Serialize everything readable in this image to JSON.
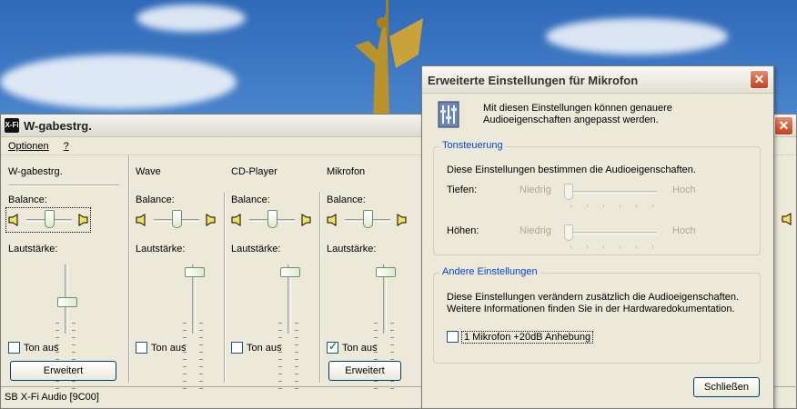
{
  "mixer": {
    "title": "W-gabestrg.",
    "menu": {
      "options": "Optionen",
      "help": "?"
    },
    "channels": [
      {
        "name": "W-gabestrg.",
        "balance_label": "Balance:",
        "volume_label": "Lautstärke:",
        "mute_label": "Ton aus",
        "muted": false,
        "has_advanced": true,
        "volume_level": 0.4
      },
      {
        "name": "Wave",
        "balance_label": "Balance:",
        "volume_label": "Lautstärke:",
        "mute_label": "Ton aus",
        "muted": false,
        "has_advanced": false,
        "volume_level": 0.95
      },
      {
        "name": "CD-Player",
        "balance_label": "Balance:",
        "volume_label": "Lautstärke:",
        "mute_label": "Ton aus",
        "muted": false,
        "has_advanced": false,
        "volume_level": 0.95
      },
      {
        "name": "Mikrofon",
        "balance_label": "Balance:",
        "volume_label": "Lautstärke:",
        "mute_label": "Ton aus",
        "muted": true,
        "has_advanced": true,
        "volume_level": 0.95
      }
    ],
    "advanced_label": "Erweitert",
    "status": "SB X-Fi Audio [9C00]"
  },
  "dialog": {
    "title": "Erweiterte Einstellungen für Mikrofon",
    "description": "Mit diesen Einstellungen können genauere Audioeigenschaften angepasst werden.",
    "tone": {
      "title": "Tonsteuerung",
      "text": "Diese Einstellungen bestimmen die Audioeigenschaften.",
      "bass_label": "Tiefen:",
      "treble_label": "Höhen:",
      "low": "Niedrig",
      "high": "Hoch"
    },
    "other": {
      "title": "Andere Einstellungen",
      "text1": "Diese Einstellungen verändern zusätzlich die Audioeigenschaften.",
      "text2": "Weitere Informationen finden Sie in der Hardwaredokumentation.",
      "option_label": "1  Mikrofon +20dB Anhebung",
      "option_checked": false
    },
    "close_label": "Schließen"
  },
  "colors": {
    "group_title": "#0046d5",
    "close_red": "#c4411c",
    "window_bg": "#ece9d8"
  }
}
